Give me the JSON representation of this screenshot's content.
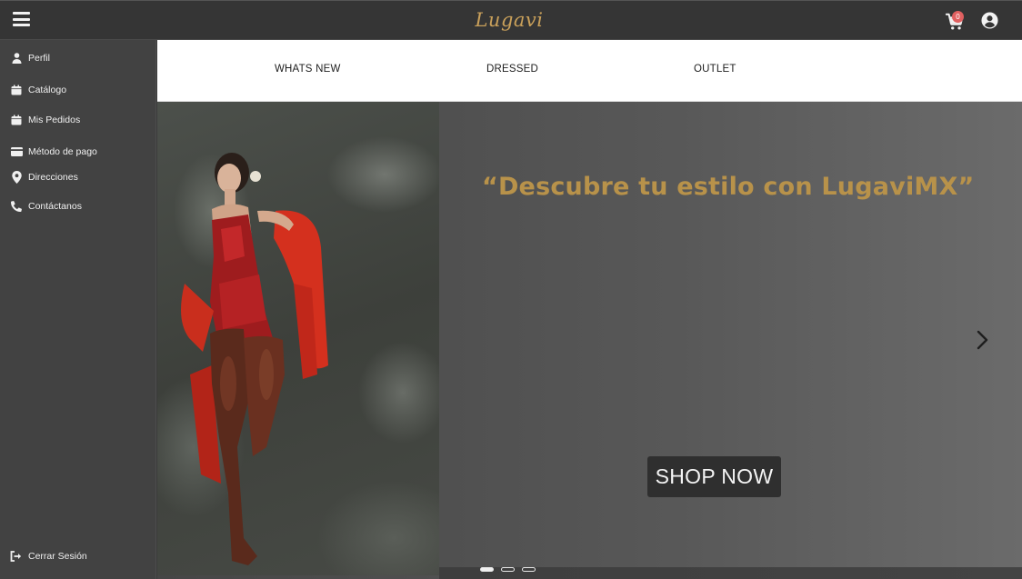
{
  "header": {
    "logo_text": "Lugavi",
    "cart_count": "0",
    "brand_color": "#c9a05a"
  },
  "sidebar": {
    "items": [
      {
        "label": "Perfil",
        "icon": "user-icon"
      },
      {
        "label": "Catálogo",
        "icon": "catalog-icon"
      },
      {
        "label": "Mis Pedidos",
        "icon": "orders-icon"
      },
      {
        "label": "Método de pago",
        "icon": "credit-card-icon"
      },
      {
        "label": "Direcciones",
        "icon": "map-pin-icon"
      },
      {
        "label": "Contáctanos",
        "icon": "phone-icon"
      }
    ],
    "logout_label": "Cerrar Sesión"
  },
  "nav": {
    "items": [
      "WHATS NEW",
      "DRESSED",
      "OUTLET"
    ]
  },
  "hero": {
    "quote": "“Descubre tu estilo con LugaviMX”",
    "cta_label": "SHOP NOW",
    "slide_count": 3,
    "active_slide": 1,
    "quote_color": "#b8924a"
  }
}
